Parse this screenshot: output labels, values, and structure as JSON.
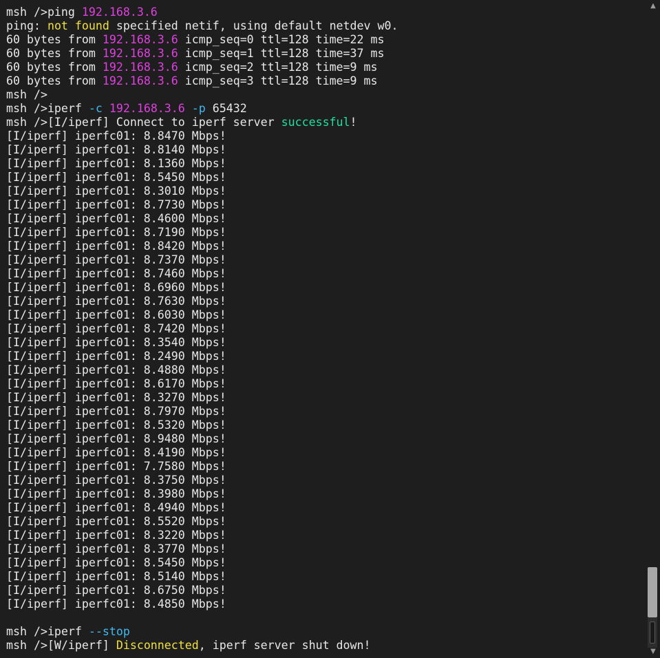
{
  "terminal": {
    "colors": {
      "background": "#1e1e1e",
      "text": "#e8e8e8",
      "ip": "#e040e0",
      "warning": "#f0e040",
      "flag": "#40b8f0",
      "success": "#20e0a0"
    },
    "scrollbar": {
      "up_icon": "▲",
      "down_icon": "▼"
    },
    "lines": [
      [
        {
          "t": "msh />ping ",
          "c": "default"
        },
        {
          "t": "192.168.3.6",
          "c": "magenta"
        }
      ],
      [
        {
          "t": "ping: ",
          "c": "default"
        },
        {
          "t": "not found",
          "c": "yellow"
        },
        {
          "t": " specified netif, using default netdev w0.",
          "c": "default"
        }
      ],
      [
        {
          "t": "60 bytes from ",
          "c": "default"
        },
        {
          "t": "192.168.3.6",
          "c": "magenta"
        },
        {
          "t": " icmp_seq=0 ttl=128 time=22 ms",
          "c": "default"
        }
      ],
      [
        {
          "t": "60 bytes from ",
          "c": "default"
        },
        {
          "t": "192.168.3.6",
          "c": "magenta"
        },
        {
          "t": " icmp_seq=1 ttl=128 time=37 ms",
          "c": "default"
        }
      ],
      [
        {
          "t": "60 bytes from ",
          "c": "default"
        },
        {
          "t": "192.168.3.6",
          "c": "magenta"
        },
        {
          "t": " icmp_seq=2 ttl=128 time=9 ms",
          "c": "default"
        }
      ],
      [
        {
          "t": "60 bytes from ",
          "c": "default"
        },
        {
          "t": "192.168.3.6",
          "c": "magenta"
        },
        {
          "t": " icmp_seq=3 ttl=128 time=9 ms",
          "c": "default"
        }
      ],
      [
        {
          "t": "msh />",
          "c": "default"
        }
      ],
      [
        {
          "t": "msh />iperf ",
          "c": "default"
        },
        {
          "t": "-c",
          "c": "cyan"
        },
        {
          "t": " ",
          "c": "default"
        },
        {
          "t": "192.168.3.6",
          "c": "magenta"
        },
        {
          "t": " ",
          "c": "default"
        },
        {
          "t": "-p",
          "c": "cyan"
        },
        {
          "t": " 65432",
          "c": "default"
        }
      ],
      [
        {
          "t": "msh />[I/iperf] Connect to iperf server ",
          "c": "default"
        },
        {
          "t": "successful",
          "c": "green"
        },
        {
          "t": "!",
          "c": "default"
        }
      ],
      [
        {
          "t": "[I/iperf] iperfc01: 8.8470 Mbps!",
          "c": "default"
        }
      ],
      [
        {
          "t": "[I/iperf] iperfc01: 8.8140 Mbps!",
          "c": "default"
        }
      ],
      [
        {
          "t": "[I/iperf] iperfc01: 8.1360 Mbps!",
          "c": "default"
        }
      ],
      [
        {
          "t": "[I/iperf] iperfc01: 8.5450 Mbps!",
          "c": "default"
        }
      ],
      [
        {
          "t": "[I/iperf] iperfc01: 8.3010 Mbps!",
          "c": "default"
        }
      ],
      [
        {
          "t": "[I/iperf] iperfc01: 8.7730 Mbps!",
          "c": "default"
        }
      ],
      [
        {
          "t": "[I/iperf] iperfc01: 8.4600 Mbps!",
          "c": "default"
        }
      ],
      [
        {
          "t": "[I/iperf] iperfc01: 8.7190 Mbps!",
          "c": "default"
        }
      ],
      [
        {
          "t": "[I/iperf] iperfc01: 8.8420 Mbps!",
          "c": "default"
        }
      ],
      [
        {
          "t": "[I/iperf] iperfc01: 8.7370 Mbps!",
          "c": "default"
        }
      ],
      [
        {
          "t": "[I/iperf] iperfc01: 8.7460 Mbps!",
          "c": "default"
        }
      ],
      [
        {
          "t": "[I/iperf] iperfc01: 8.6960 Mbps!",
          "c": "default"
        }
      ],
      [
        {
          "t": "[I/iperf] iperfc01: 8.7630 Mbps!",
          "c": "default"
        }
      ],
      [
        {
          "t": "[I/iperf] iperfc01: 8.6030 Mbps!",
          "c": "default"
        }
      ],
      [
        {
          "t": "[I/iperf] iperfc01: 8.7420 Mbps!",
          "c": "default"
        }
      ],
      [
        {
          "t": "[I/iperf] iperfc01: 8.3540 Mbps!",
          "c": "default"
        }
      ],
      [
        {
          "t": "[I/iperf] iperfc01: 8.2490 Mbps!",
          "c": "default"
        }
      ],
      [
        {
          "t": "[I/iperf] iperfc01: 8.4880 Mbps!",
          "c": "default"
        }
      ],
      [
        {
          "t": "[I/iperf] iperfc01: 8.6170 Mbps!",
          "c": "default"
        }
      ],
      [
        {
          "t": "[I/iperf] iperfc01: 8.3270 Mbps!",
          "c": "default"
        }
      ],
      [
        {
          "t": "[I/iperf] iperfc01: 8.7970 Mbps!",
          "c": "default"
        }
      ],
      [
        {
          "t": "[I/iperf] iperfc01: 8.5320 Mbps!",
          "c": "default"
        }
      ],
      [
        {
          "t": "[I/iperf] iperfc01: 8.9480 Mbps!",
          "c": "default"
        }
      ],
      [
        {
          "t": "[I/iperf] iperfc01: 8.4190 Mbps!",
          "c": "default"
        }
      ],
      [
        {
          "t": "[I/iperf] iperfc01: 7.7580 Mbps!",
          "c": "default"
        }
      ],
      [
        {
          "t": "[I/iperf] iperfc01: 8.3750 Mbps!",
          "c": "default"
        }
      ],
      [
        {
          "t": "[I/iperf] iperfc01: 8.3980 Mbps!",
          "c": "default"
        }
      ],
      [
        {
          "t": "[I/iperf] iperfc01: 8.4940 Mbps!",
          "c": "default"
        }
      ],
      [
        {
          "t": "[I/iperf] iperfc01: 8.5520 Mbps!",
          "c": "default"
        }
      ],
      [
        {
          "t": "[I/iperf] iperfc01: 8.3220 Mbps!",
          "c": "default"
        }
      ],
      [
        {
          "t": "[I/iperf] iperfc01: 8.3770 Mbps!",
          "c": "default"
        }
      ],
      [
        {
          "t": "[I/iperf] iperfc01: 8.5450 Mbps!",
          "c": "default"
        }
      ],
      [
        {
          "t": "[I/iperf] iperfc01: 8.5140 Mbps!",
          "c": "default"
        }
      ],
      [
        {
          "t": "[I/iperf] iperfc01: 8.6750 Mbps!",
          "c": "default"
        }
      ],
      [
        {
          "t": "[I/iperf] iperfc01: 8.4850 Mbps!",
          "c": "default"
        }
      ],
      [],
      [
        {
          "t": "msh />iperf ",
          "c": "default"
        },
        {
          "t": "--stop",
          "c": "cyan"
        }
      ],
      [
        {
          "t": "msh />[W/iperf] ",
          "c": "default"
        },
        {
          "t": "Disconnected",
          "c": "yellow"
        },
        {
          "t": ", iperf server shut down!",
          "c": "default"
        }
      ]
    ]
  }
}
